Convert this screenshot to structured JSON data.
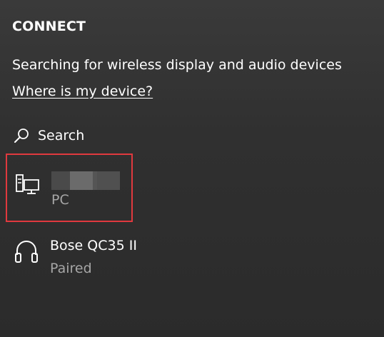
{
  "panel": {
    "title": "CONNECT",
    "status": "Searching for wireless display and audio devices",
    "help_link": "Where is my device?"
  },
  "search": {
    "icon": "search-icon",
    "label": "Search"
  },
  "devices": [
    {
      "icon": "pc-icon",
      "name": "",
      "name_redacted": true,
      "type": "PC",
      "highlighted": true
    },
    {
      "icon": "headphones-icon",
      "name": "Bose QC35 II",
      "type": "Paired",
      "highlighted": false
    }
  ],
  "colors": {
    "background": "#333333",
    "text": "#ffffff",
    "secondary_text": "#a6a6a6",
    "highlight_border": "#e0393e"
  }
}
